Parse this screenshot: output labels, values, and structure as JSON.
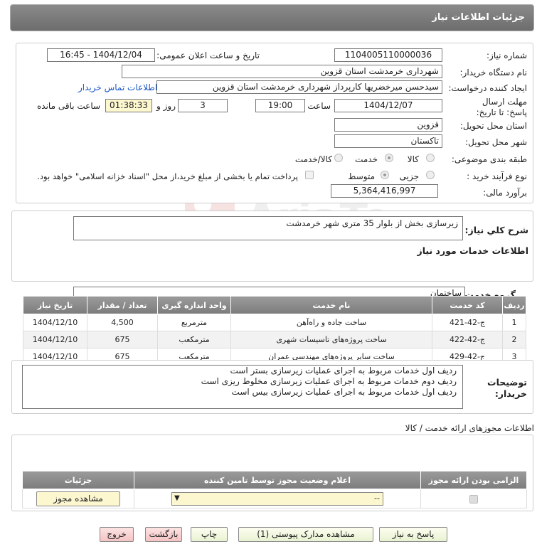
{
  "header": {
    "title": "جزئیات اطلاعات نیاز"
  },
  "labels": {
    "need_number": "شماره نیاز:",
    "announce_datetime": "تاریخ و ساعت اعلان عمومی:",
    "buyer_org": "نام دستگاه خریدار:",
    "creator": "ایجاد کننده درخواست:",
    "contact_link": "اطلاعات تماس خریدار",
    "deadline": "مهلت ارسال پاسخ: تا تاریخ:",
    "time": "ساعت",
    "days_and": "روز و",
    "remaining": "ساعت باقی مانده",
    "province": "استان محل تحویل:",
    "city": "شهر محل تحویل:",
    "category": "طبقه بندی موضوعی:",
    "process_type": "نوع فرآیند خرید :",
    "budget": "برآورد مالی:",
    "description": "شرح کلي نياز:",
    "services_info": "اطلاعات خدمات مورد نیاز",
    "service_group": "گروه خدمت:",
    "buyer_notes": "توضیحات خریدار:",
    "permits_title": "اطلاعات مجوزهای ارائه خدمت / کالا"
  },
  "values": {
    "need_number": "1104005110000036",
    "announce_datetime": "1404/12/04 - 16:45",
    "buyer_org": "شهرداری خرمدشت استان قزوین",
    "creator": "سیدحسن میرخضریها کارپرداز شهرداری خرمدشت استان قزوین",
    "deadline_date": "1404/12/07",
    "deadline_time": "19:00",
    "days": "3",
    "remaining_time": "01:38:33",
    "province": "قزوین",
    "city": "تاکستان",
    "budget": "5,364,416,997",
    "description": "زیرسازی بخش از بلوار 35 متری شهر خرمدشت",
    "service_group": "ساختمان",
    "buyer_notes": [
      "ردیف اول خدمات مربوط به اجرای عملیات زیرسازی بستر است",
      "ردیف دوم خدمات مربوط به اجرای عملیات زیرسازی مخلوط ریزی است",
      "ردیف اول خدمات مربوط به اجرای عملیات زیرسازی بیس است"
    ]
  },
  "category_options": [
    {
      "label": "کالا",
      "selected": false
    },
    {
      "label": "خدمت",
      "selected": true
    },
    {
      "label": "کالا/خدمت",
      "selected": false
    }
  ],
  "process_options": [
    {
      "label": "جزیی",
      "selected": false
    },
    {
      "label": "متوسط",
      "selected": true
    }
  ],
  "payment_note": "پرداخت تمام یا بخشی از مبلغ خرید،از محل \"اسناد خزانه اسلامی\" خواهد بود.",
  "services_table": {
    "headers": [
      "ردیف",
      "کد خدمت",
      "نام خدمت",
      "واحد اندازه گیری",
      "تعداد / مقدار",
      "تاریخ نیاز"
    ],
    "rows": [
      [
        "1",
        "ج-42-421",
        "ساخت جاده و راه‌آهن",
        "مترمربع",
        "4,500",
        "1404/12/10"
      ],
      [
        "2",
        "ج-42-422",
        "ساخت پروژه‌های تاسیسات شهری",
        "مترمکعب",
        "675",
        "1404/12/10"
      ],
      [
        "3",
        "ج-42-429",
        "ساخت سایر پروژه‌های مهندسی عمران",
        "مترمکعب",
        "675",
        "1404/12/10"
      ]
    ]
  },
  "permits_table": {
    "headers": [
      "الزامی بودن ارائه مجوز",
      "اعلام وضعیت مجوز توسط تامین کننده",
      "جزئیات"
    ],
    "select_value": "--",
    "view_button": "مشاهده مجوز"
  },
  "buttons": {
    "reply": "پاسخ به نیاز",
    "attachments": "مشاهده مدارک پیوستی (1)",
    "print": "چاپ",
    "back": "بازگشت",
    "exit": "خروج"
  },
  "colors": {
    "header_bg": "#7a7a7a",
    "link": "#1a57c4",
    "remaining_bg": "#fdf7d0"
  }
}
